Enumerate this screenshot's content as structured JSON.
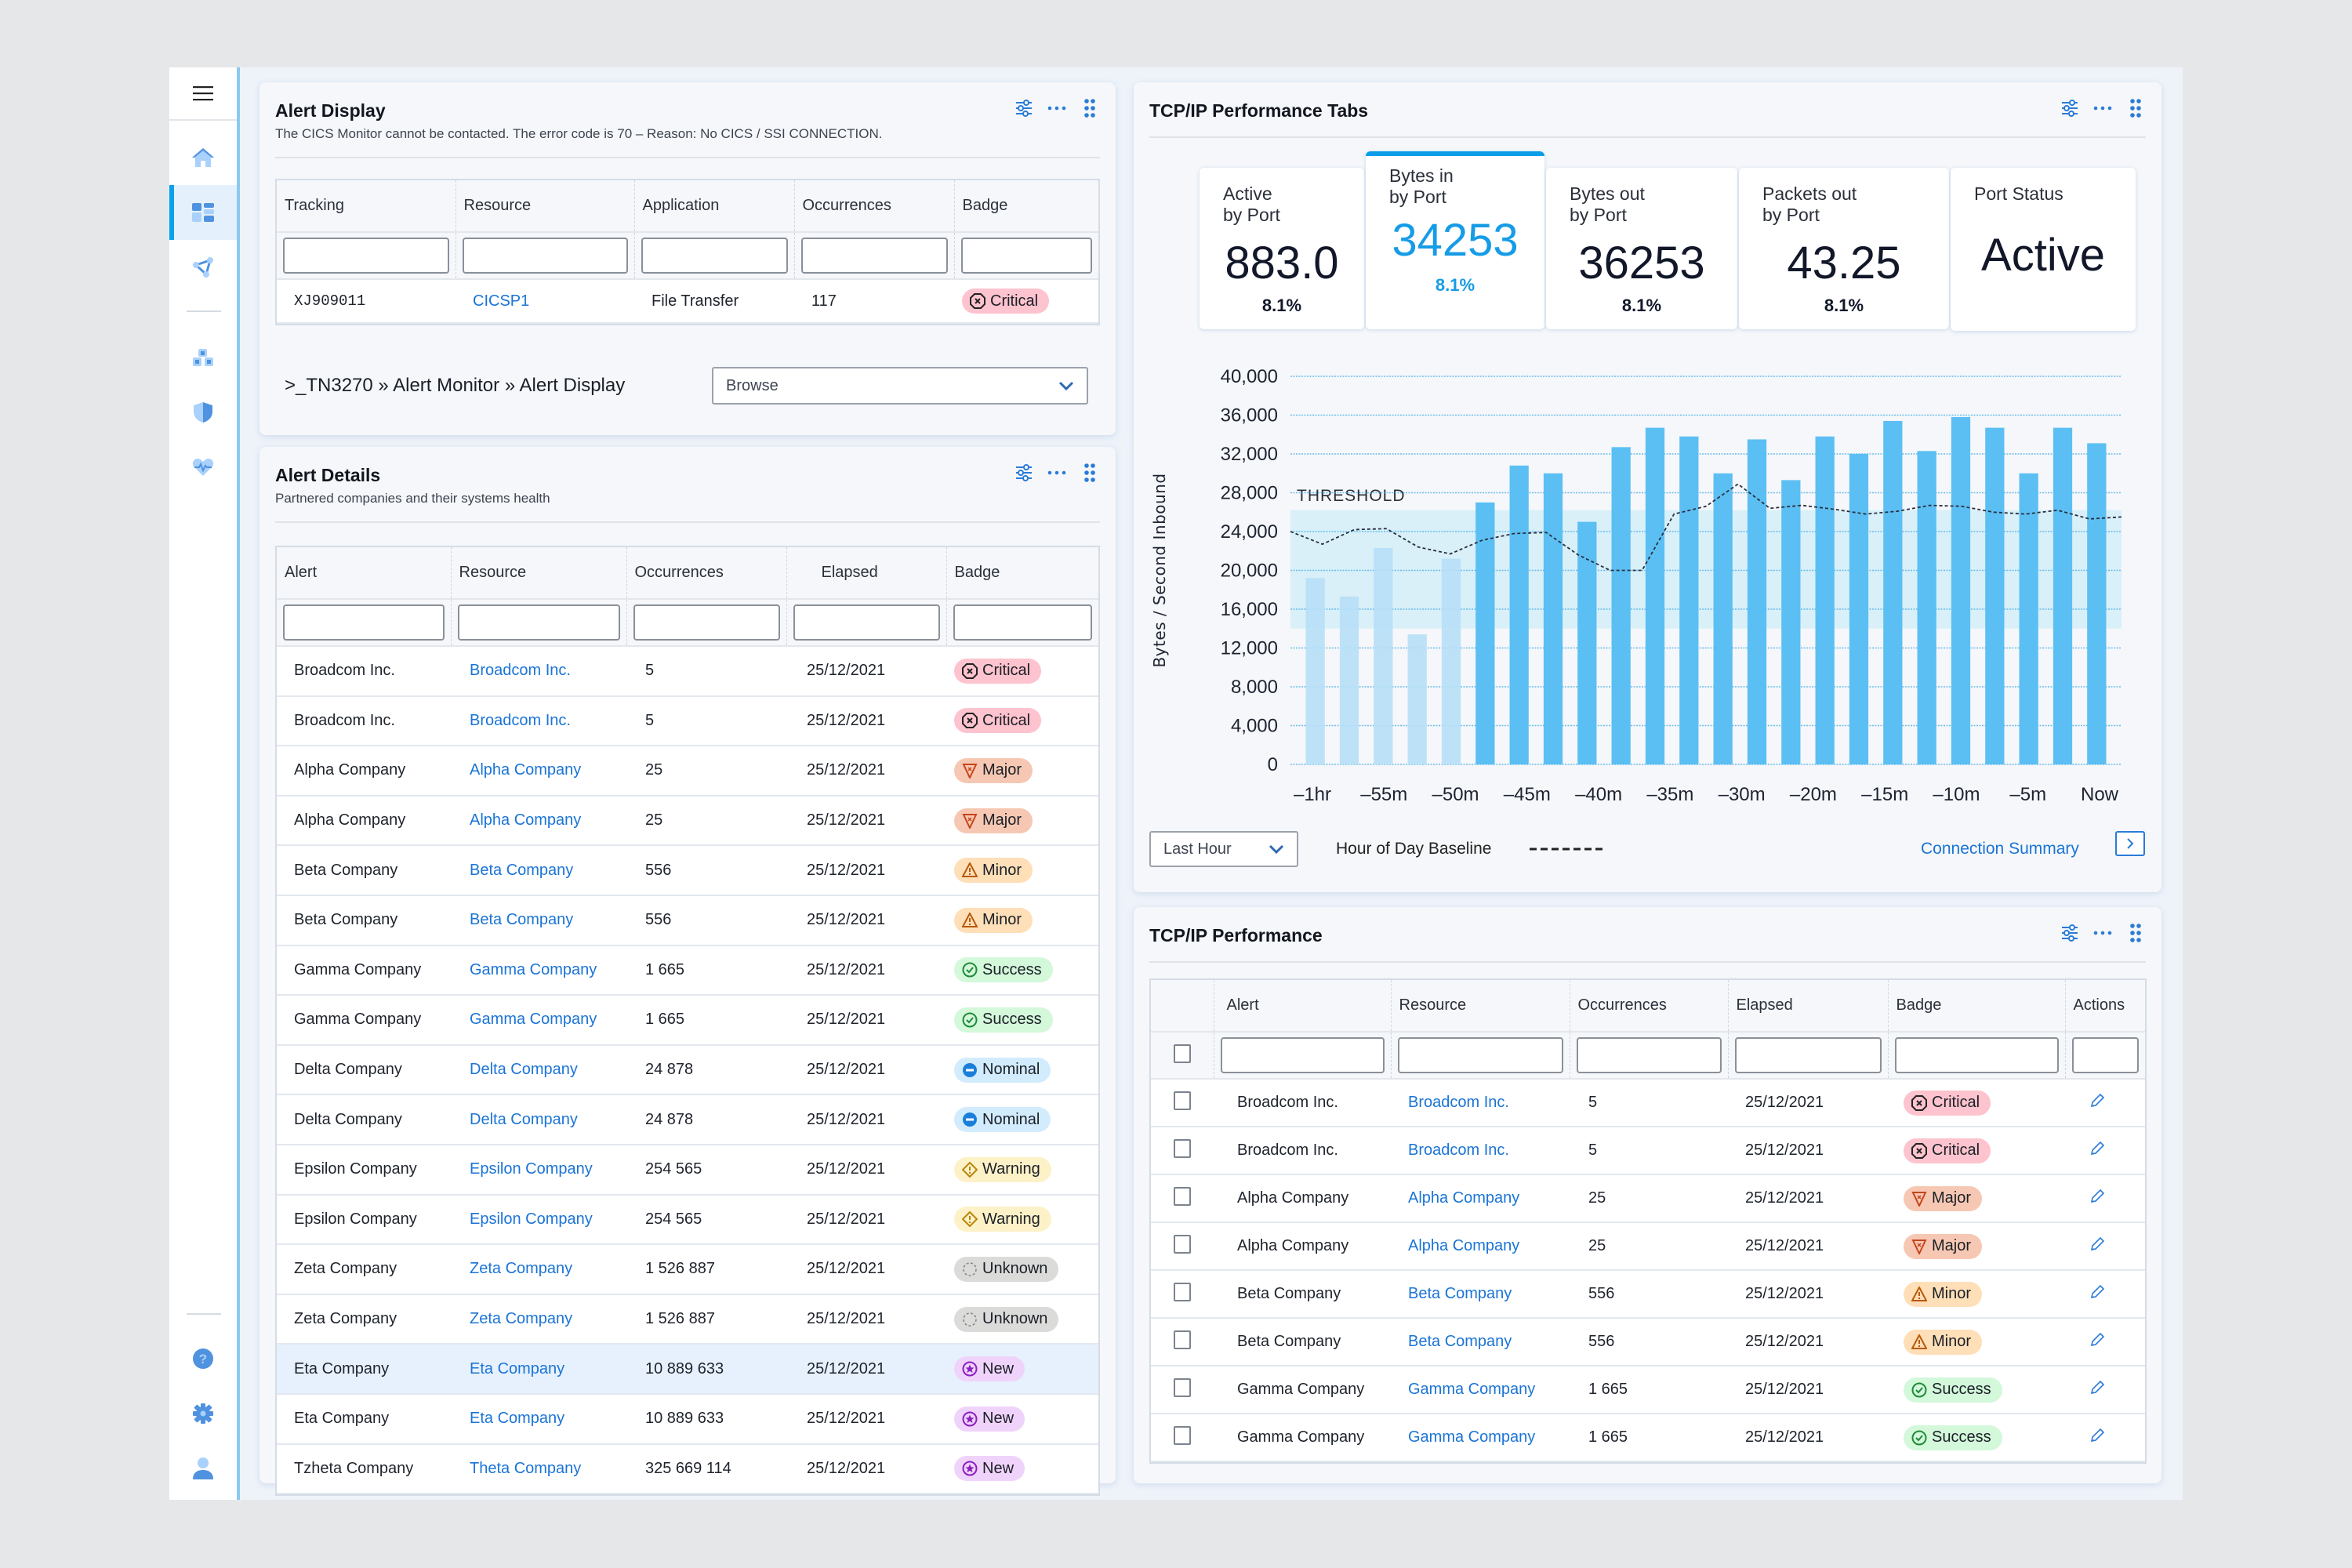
{
  "sidebar": {
    "items": [
      {
        "name": "menu",
        "icon": "hamburger-icon"
      },
      {
        "name": "home",
        "icon": "home-icon"
      },
      {
        "name": "dashboard",
        "icon": "dashboard-icon",
        "active": true
      },
      {
        "name": "network",
        "icon": "network-icon"
      },
      {
        "name": "modules",
        "icon": "cubes-icon"
      },
      {
        "name": "security",
        "icon": "shield-icon"
      },
      {
        "name": "health",
        "icon": "heart-pulse-icon"
      },
      {
        "name": "help",
        "icon": "help-icon"
      },
      {
        "name": "settings",
        "icon": "gear-icon"
      },
      {
        "name": "profile",
        "icon": "user-icon"
      }
    ]
  },
  "alert_display": {
    "title": "Alert Display",
    "subtitle": "The CICS Monitor cannot be contacted. The error code is 70 – Reason: No CICS / SSI CONNECTION.",
    "columns": [
      "Tracking",
      "Resource",
      "Application",
      "Occurrences",
      "Badge"
    ],
    "rows": [
      {
        "tracking": "XJ909011",
        "resource": "CICSP1",
        "application": "File Transfer",
        "occurrences": "117",
        "badge": "Critical"
      }
    ],
    "breadcrumb": ">_TN3270 » Alert Monitor » Alert Display",
    "browse_select": "Browse"
  },
  "alert_details": {
    "title": "Alert Details",
    "subtitle": "Partnered companies and their systems health",
    "columns": [
      "Alert",
      "Resource",
      "Occurrences",
      "Elapsed",
      "Badge"
    ],
    "rows": [
      {
        "alert": "Broadcom Inc.",
        "resource": "Broadcom Inc.",
        "occurrences": "5",
        "elapsed": "25/12/2021",
        "badge": "Critical"
      },
      {
        "alert": "Broadcom Inc.",
        "resource": "Broadcom Inc.",
        "occurrences": "5",
        "elapsed": "25/12/2021",
        "badge": "Critical"
      },
      {
        "alert": "Alpha Company",
        "resource": "Alpha Company",
        "occurrences": "25",
        "elapsed": "25/12/2021",
        "badge": "Major"
      },
      {
        "alert": "Alpha Company",
        "resource": "Alpha Company",
        "occurrences": "25",
        "elapsed": "25/12/2021",
        "badge": "Major"
      },
      {
        "alert": "Beta Company",
        "resource": "Beta Company",
        "occurrences": "556",
        "elapsed": "25/12/2021",
        "badge": "Minor"
      },
      {
        "alert": "Beta Company",
        "resource": "Beta Company",
        "occurrences": "556",
        "elapsed": "25/12/2021",
        "badge": "Minor"
      },
      {
        "alert": "Gamma Company",
        "resource": "Gamma Company",
        "occurrences": "1 665",
        "elapsed": "25/12/2021",
        "badge": "Success"
      },
      {
        "alert": "Gamma Company",
        "resource": "Gamma Company",
        "occurrences": "1 665",
        "elapsed": "25/12/2021",
        "badge": "Success"
      },
      {
        "alert": "Delta Company",
        "resource": "Delta Company",
        "occurrences": "24 878",
        "elapsed": "25/12/2021",
        "badge": "Nominal"
      },
      {
        "alert": "Delta Company",
        "resource": "Delta Company",
        "occurrences": "24 878",
        "elapsed": "25/12/2021",
        "badge": "Nominal"
      },
      {
        "alert": "Epsilon Company",
        "resource": "Epsilon Company",
        "occurrences": "254 565",
        "elapsed": "25/12/2021",
        "badge": "Warning"
      },
      {
        "alert": "Epsilon Company",
        "resource": "Epsilon Company",
        "occurrences": "254 565",
        "elapsed": "25/12/2021",
        "badge": "Warning"
      },
      {
        "alert": "Zeta Company",
        "resource": "Zeta Company",
        "occurrences": "1 526 887",
        "elapsed": "25/12/2021",
        "badge": "Unknown"
      },
      {
        "alert": "Zeta Company",
        "resource": "Zeta Company",
        "occurrences": "1 526 887",
        "elapsed": "25/12/2021",
        "badge": "Unknown"
      },
      {
        "alert": "Eta Company",
        "resource": "Eta Company",
        "occurrences": "10 889 633",
        "elapsed": "25/12/2021",
        "badge": "New",
        "highlighted": true
      },
      {
        "alert": "Eta Company",
        "resource": "Eta Company",
        "occurrences": "10 889 633",
        "elapsed": "25/12/2021",
        "badge": "New"
      },
      {
        "alert": "Tzheta Company",
        "resource": "Theta Company",
        "occurrences": "325 669 114",
        "elapsed": "25/12/2021",
        "badge": "New"
      }
    ]
  },
  "tcp_tabs": {
    "title": "TCP/IP Performance Tabs",
    "kpis": [
      {
        "label1": "Active",
        "label2": "by Port",
        "value": "883.0",
        "pct": "8.1%"
      },
      {
        "label1": "Bytes in",
        "label2": "by Port",
        "value": "34253",
        "pct": "8.1%",
        "active": true
      },
      {
        "label1": "Bytes out",
        "label2": "by Port",
        "value": "36253",
        "pct": "8.1%"
      },
      {
        "label1": "Packets out",
        "label2": "by Port",
        "value": "43.25",
        "pct": "8.1%"
      },
      {
        "label1": "Port Status",
        "label2": "",
        "value": "Active",
        "pct": ""
      }
    ],
    "range_select": "Last Hour",
    "baseline_label": "Hour of Day Baseline",
    "connection_summary": "Connection Summary"
  },
  "chart_data": {
    "type": "bar",
    "title": "",
    "xlabel": "",
    "ylabel": "Bytes / Second Inbound",
    "ylim": [
      0,
      40000
    ],
    "yticks": [
      0,
      4000,
      8000,
      12000,
      16000,
      20000,
      24000,
      28000,
      32000,
      36000,
      40000
    ],
    "ytick_labels": [
      "0",
      "4,000",
      "8,000",
      "12,000",
      "16,000",
      "20,000",
      "24,000",
      "28,000",
      "32,000",
      "36,000",
      "40,000"
    ],
    "xtick_labels": [
      "–1hr",
      "–55m",
      "–50m",
      "–45m",
      "–40m",
      "–35m",
      "–30m",
      "–20m",
      "–15m",
      "–10m",
      "–5m",
      "Now"
    ],
    "grid": true,
    "threshold": {
      "label": "THRESHOLD",
      "low": 14000,
      "high": 26200
    },
    "series": [
      {
        "name": "Bytes in",
        "values": [
          19200,
          17300,
          22300,
          13400,
          21200,
          27000,
          30800,
          30000,
          25000,
          32700,
          34700,
          33800,
          30000,
          33500,
          29300,
          33800,
          32000,
          35400,
          32300,
          35800,
          34700,
          30000,
          34700,
          33100
        ],
        "faded_count": 5
      },
      {
        "name": "Hour of Day Baseline",
        "style": "dashed",
        "values": [
          24000,
          22700,
          24200,
          24300,
          22400,
          21700,
          23100,
          23800,
          23900,
          21600,
          20000,
          20000,
          25800,
          26600,
          28900,
          26400,
          26700,
          26300,
          25800,
          26100,
          26700,
          26600,
          26000,
          25800,
          26200,
          25300,
          25500
        ]
      }
    ]
  },
  "tcp_perf": {
    "title": "TCP/IP Performance",
    "columns": [
      "",
      "Alert",
      "Resource",
      "Occurrences",
      "Elapsed",
      "Badge",
      "Actions"
    ],
    "rows": [
      {
        "alert": "Broadcom Inc.",
        "resource": "Broadcom Inc.",
        "occurrences": "5",
        "elapsed": "25/12/2021",
        "badge": "Critical"
      },
      {
        "alert": "Broadcom Inc.",
        "resource": "Broadcom Inc.",
        "occurrences": "5",
        "elapsed": "25/12/2021",
        "badge": "Critical"
      },
      {
        "alert": "Alpha Company",
        "resource": "Alpha Company",
        "occurrences": "25",
        "elapsed": "25/12/2021",
        "badge": "Major"
      },
      {
        "alert": "Alpha Company",
        "resource": "Alpha Company",
        "occurrences": "25",
        "elapsed": "25/12/2021",
        "badge": "Major"
      },
      {
        "alert": "Beta Company",
        "resource": "Beta Company",
        "occurrences": "556",
        "elapsed": "25/12/2021",
        "badge": "Minor"
      },
      {
        "alert": "Beta Company",
        "resource": "Beta Company",
        "occurrences": "556",
        "elapsed": "25/12/2021",
        "badge": "Minor"
      },
      {
        "alert": "Gamma Company",
        "resource": "Gamma Company",
        "occurrences": "1 665",
        "elapsed": "25/12/2021",
        "badge": "Success"
      },
      {
        "alert": "Gamma Company",
        "resource": "Gamma Company",
        "occurrences": "1 665",
        "elapsed": "25/12/2021",
        "badge": "Success"
      }
    ]
  },
  "colors": {
    "accent": "#0a9ee8",
    "link": "#1a74d6",
    "bar": "#5bbff3",
    "bar_faded": "#b7dff7",
    "threshold_band": "#d4eef8"
  }
}
